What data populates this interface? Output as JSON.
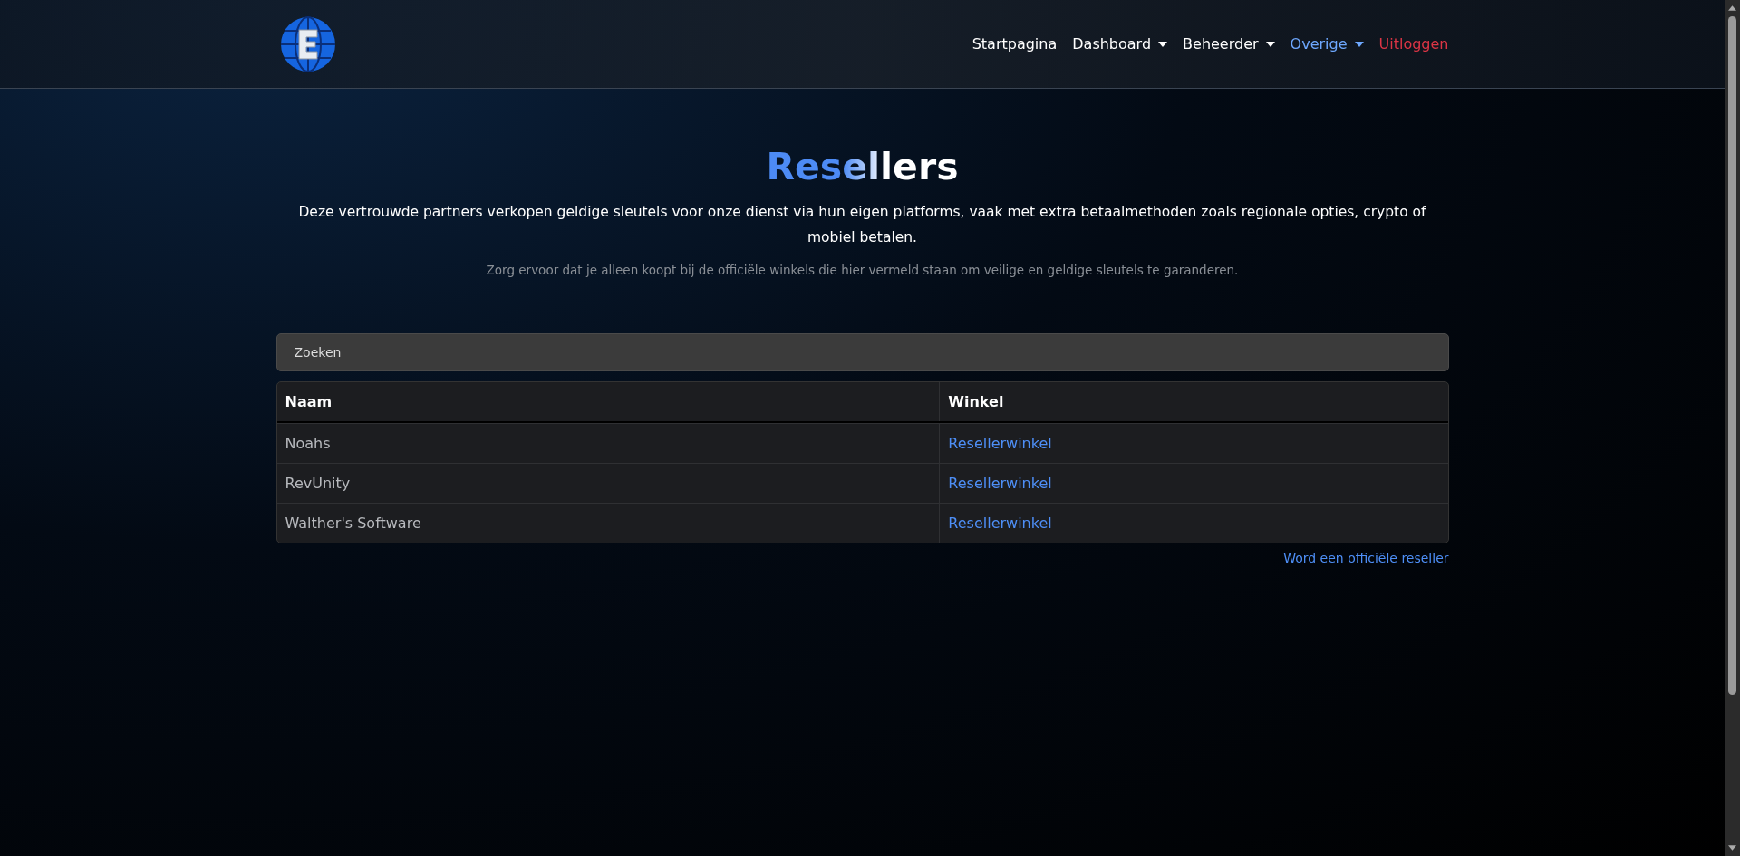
{
  "nav": {
    "items": [
      {
        "label": "Startpagina",
        "kind": "link",
        "dropdown": false,
        "selected": false
      },
      {
        "label": "Dashboard",
        "kind": "link",
        "dropdown": true,
        "selected": false
      },
      {
        "label": "Beheerder",
        "kind": "link",
        "dropdown": true,
        "selected": false
      },
      {
        "label": "Overige",
        "kind": "link",
        "dropdown": true,
        "selected": true
      },
      {
        "label": "Uitloggen",
        "kind": "logout",
        "dropdown": false,
        "selected": false
      }
    ]
  },
  "page": {
    "title": "Resellers",
    "intro": "Deze vertrouwde partners verkopen geldige sleutels voor onze dienst via hun eigen platforms, vaak met extra betaalmethoden zoals regionale opties, crypto of mobiel betalen.",
    "note": "Zorg ervoor dat je alleen koopt bij de officiële winkels die hier vermeld staan om veilige en geldige sleutels te garanderen."
  },
  "search": {
    "placeholder": "Zoeken"
  },
  "table": {
    "columns": [
      "Naam",
      "Winkel"
    ],
    "rows": [
      {
        "name": "Noahs",
        "shop": "Resellerwinkel"
      },
      {
        "name": "RevUnity",
        "shop": "Resellerwinkel"
      },
      {
        "name": "Walther's Software",
        "shop": "Resellerwinkel"
      }
    ]
  },
  "become_reseller": "Word een officiële reseller"
}
